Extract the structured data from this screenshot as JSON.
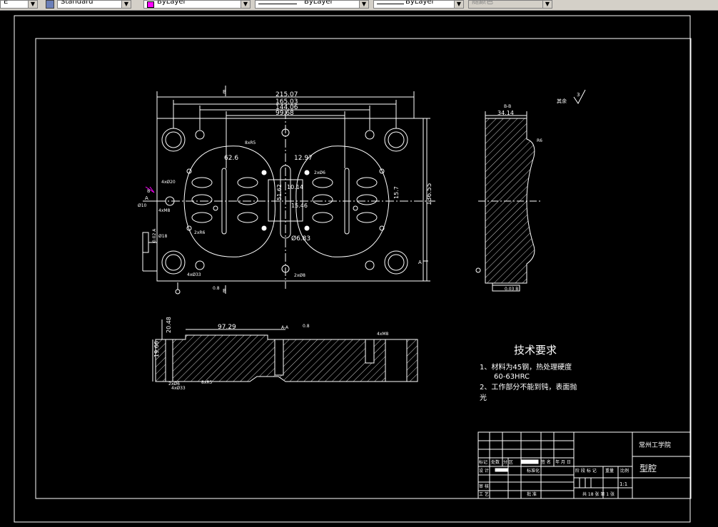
{
  "toolbar": {
    "first_value": "E",
    "textstyle": "Standard",
    "color": "ByLayer",
    "color_swatch": "#ff00ff",
    "linetype": "ByLayer",
    "lineweight": "ByLayer",
    "plotstyle": "随颜色"
  },
  "drawing": {
    "top_dims": [
      "215.07",
      "165.03",
      "144.06",
      "99.68"
    ],
    "view_labels": {
      "b_top": "B",
      "b_bottom": "B",
      "a_left": "A",
      "a_right": "A",
      "bb": "B-B",
      "aa": "A-A"
    },
    "callouts": {
      "d62": "62.6",
      "d1297": "12.97",
      "d5162": "51.62",
      "d2741": "27.41",
      "d1014": "10.14",
      "d1546": "15.46",
      "d683": "Ø6.83",
      "d157": "15.7",
      "d13655": "136.55",
      "d3414": "34.14",
      "d2048": "20.48",
      "d9729": "97.29",
      "d1966": "19.66",
      "d0_8": "0.8",
      "d8": "8",
      "r6": "R6"
    },
    "small_notes": {
      "hole1": "Ø18",
      "hole2": "2xR6",
      "hole3": "4xØ20",
      "hole4": "4xØ33",
      "hole5": "2xØ8",
      "hole6": "8xR5",
      "hole7": "2xØ6",
      "hole8": "Ø10",
      "hole9": "4xM8",
      "note1": "4xØ33",
      "tol1": "0.02 A",
      "tol2": "0.02 A",
      "tol3": "0.03 B",
      "other": "其余",
      "rough": "3"
    }
  },
  "tech": {
    "title": "技术要求",
    "line1": "1、材料为45钢，热处理硬度",
    "line2": "60-63HRC",
    "line3": "2、工作部分不能到钝，表面抛",
    "line4": "光"
  },
  "titleblock": {
    "school": "常州工学院",
    "part": "型腔",
    "scale": "1:1",
    "labels": [
      "标记",
      "处数",
      "分 区",
      "更改文件号",
      "签 名",
      "年 月 日"
    ],
    "row2": [
      "设 计",
      "标准化",
      "阶 段 标 记",
      "重量",
      "比例"
    ],
    "row3": [
      "审 核"
    ],
    "row4": [
      "工 艺",
      "批 准"
    ],
    "sheets": "共 18 张 第 1 张"
  }
}
